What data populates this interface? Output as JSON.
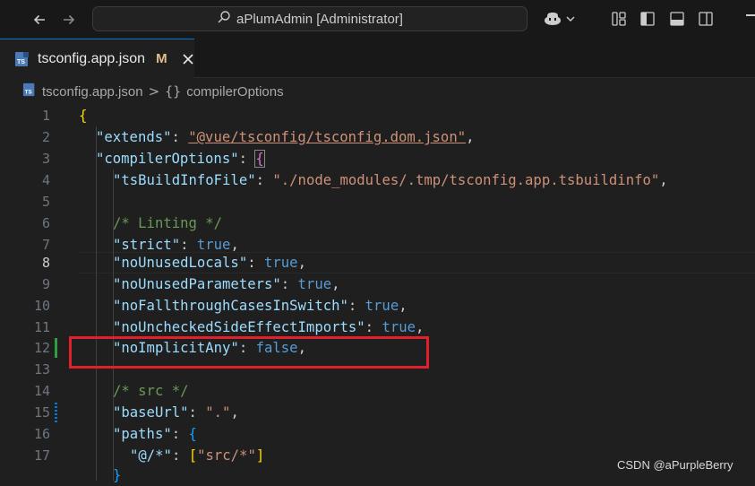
{
  "titlebar": {
    "search_label": "aPlumAdmin [Administrator]",
    "icons": [
      "arrow-left-icon",
      "arrow-right-icon",
      "search-icon",
      "copilot-icon",
      "chevron-down-icon",
      "customize-layout-icon",
      "toggle-primary-sidebar-icon",
      "toggle-panel-icon",
      "toggle-secondary-sidebar-icon"
    ]
  },
  "tab": {
    "label": "tsconfig.app.json",
    "modified_marker": "M",
    "icon": "ts-config-file-icon"
  },
  "breadcrumb": {
    "file": "tsconfig.app.json",
    "separator": ">",
    "symbol_icon": "{}",
    "symbol": "compilerOptions"
  },
  "editor": {
    "active_line": "8",
    "line_numbers": [
      "1",
      "2",
      "3",
      "4",
      "5",
      "6",
      "7",
      "8",
      "9",
      "10",
      "11",
      "12",
      "13",
      "14",
      "15",
      "16",
      "17"
    ],
    "code": {
      "open_brace": "{",
      "extends_key": "\"extends\"",
      "extends_value": "\"@vue/tsconfig/tsconfig.dom.json\"",
      "compiler_key": "\"compilerOptions\"",
      "build_info_key": "\"tsBuildInfoFile\"",
      "build_info_value": "\"./node_modules/.tmp/tsconfig.app.tsbuildinfo\"",
      "comment_linting": "/* Linting */",
      "strict_key": "\"strict\"",
      "unused_locals_key": "\"noUnusedLocals\"",
      "unused_params_key": "\"noUnusedParameters\"",
      "fallthrough_key": "\"noFallthroughCasesInSwitch\"",
      "side_effect_key": "\"noUncheckedSideEffectImports\"",
      "implicit_any_key": "\"noImplicitAny\"",
      "comment_src": "/* src */",
      "base_url_key": "\"baseUrl\"",
      "base_url_value": "\".\"",
      "paths_key": "\"paths\"",
      "alias_key": "\"@/*\"",
      "alias_value": "\"src/*\"",
      "true_value": "true",
      "false_value": "false",
      "colon": ": ",
      "comma": ",",
      "open_bracket": "[",
      "close_bracket": "]",
      "close_brace": "}"
    }
  },
  "highlight_color": "#e0202a",
  "watermark": "CSDN @aPurpleBerry"
}
